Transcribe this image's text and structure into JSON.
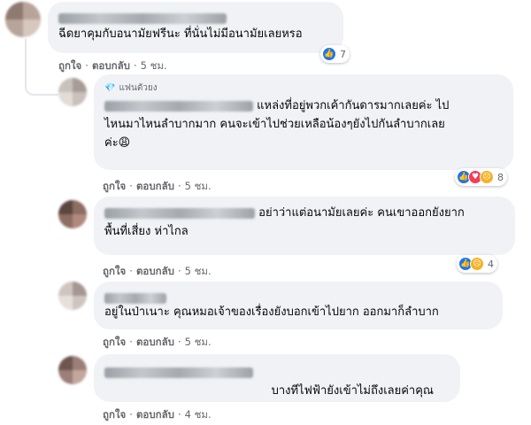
{
  "comments": [
    {
      "text": "ฉีดยาคุมกับอนามัยฟรีนะ ที่นั่นไม่มีอนามัยเลยหรอ",
      "like": "ถูกใจ",
      "reply": "ตอบกลับ",
      "time": "5 ชม.",
      "reaction_count": "7",
      "reactions": [
        "like-icon"
      ]
    },
    {
      "badge": "แฟนตัวยง",
      "text_line1": "แหล่งที่อยู่พวกเค้ากันดารมากเลยค่ะ ไป",
      "text_line2": "ไหนมาไหนลำบากมาก คนจะเข้าไปช่วยเหลือน้องๆยังไปกันลำบากเลย",
      "text_line3": "ค่ะ😩",
      "like": "ถูกใจ",
      "reply": "ตอบกลับ",
      "time": "5 ชม.",
      "reaction_count": "8",
      "reactions": [
        "like-icon",
        "love-icon",
        "sad-icon"
      ]
    },
    {
      "text_line1": "อย่าว่าแต่อนามัยเลยค่ะ คนเขาออกยังยาก",
      "text_line2": "พื้นที่เสี่ยง ห่าไกล",
      "like": "ถูกใจ",
      "reply": "ตอบกลับ",
      "time": "5 ชม.",
      "reaction_count": "4",
      "reactions": [
        "like-icon",
        "sad-icon"
      ]
    },
    {
      "text": "อยู่ในป่าเนาะ คุณหมอเจ้าของเรื่องยังบอกเข้าไปยาก ออกมาก็ลำบาก",
      "like": "ถูกใจ",
      "reply": "ตอบกลับ",
      "time": "5 ชม."
    },
    {
      "text": "บางทีไฟฟ้ายังเข้าไม่ถึงเลยค่าคุณ",
      "like": "ถูกใจ",
      "reply": "ตอบกลับ",
      "time": "4 ชม."
    }
  ],
  "colors": {
    "bubble": "#f0f2f5",
    "meta": "#65676b",
    "like_blue": "#1877f2",
    "love_red": "#f33e58",
    "sad_yellow": "#f7b125"
  }
}
